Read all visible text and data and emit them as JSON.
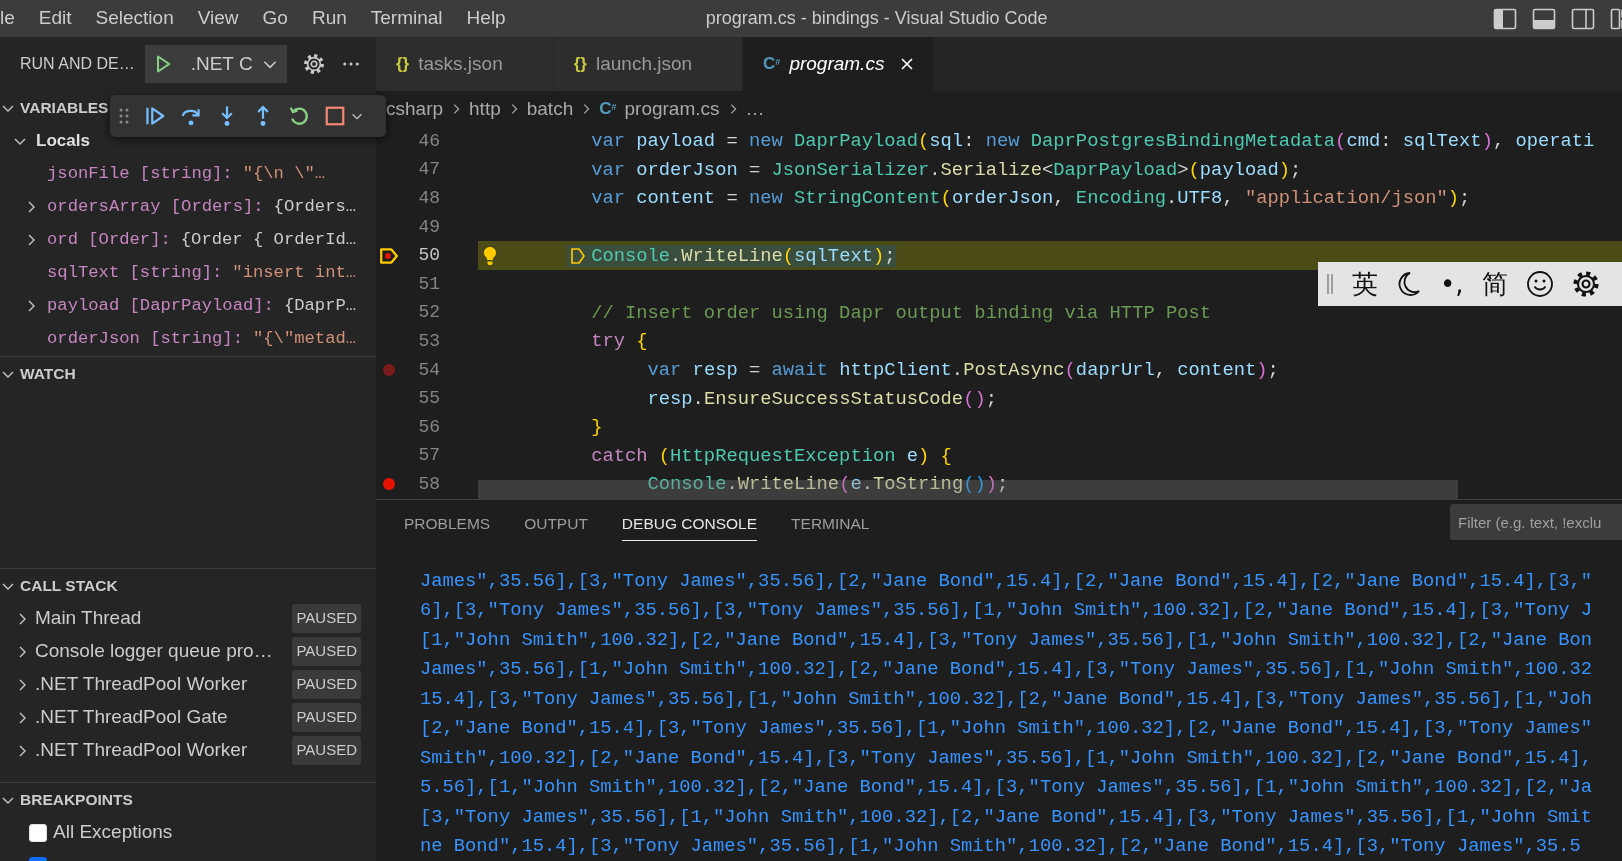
{
  "menu": [
    "le",
    "Edit",
    "Selection",
    "View",
    "Go",
    "Run",
    "Terminal",
    "Help"
  ],
  "window": {
    "title": "program.cs - bindings - Visual Studio Code"
  },
  "debug_header": {
    "title": "RUN AND DE…",
    "config": ".NET C"
  },
  "sections": [
    {
      "title": "VARIABLES",
      "expanded": true,
      "kind": "variables",
      "scopes": [
        {
          "label": "Locals",
          "expanded": true,
          "children": [
            {
              "label": "jsonFile [string]:",
              "value": "\"{\\n    \\\"…",
              "kind": "string",
              "expandable": false
            },
            {
              "label": "ordersArray [Orders]:",
              "value": "{Orders…",
              "kind": "object",
              "expandable": true
            },
            {
              "label": "ord [Order]:",
              "value": "{Order { OrderId…",
              "kind": "object",
              "expandable": true
            },
            {
              "label": "sqlText [string]:",
              "value": "\"insert int…",
              "kind": "string",
              "expandable": false
            },
            {
              "label": "payload [DaprPayload]:",
              "value": "{DaprP…",
              "kind": "object",
              "expandable": true
            },
            {
              "label": "orderJson [string]:",
              "value": "\"{\\\"metad…",
              "kind": "string",
              "expandable": false
            }
          ]
        }
      ]
    },
    {
      "title": "WATCH",
      "expanded": true,
      "kind": "watch"
    },
    {
      "title": "CALL STACK",
      "expanded": true,
      "kind": "threads",
      "items": [
        {
          "label": "Main Thread",
          "status": "PAUSED",
          "expanded": false
        },
        {
          "label": "Console logger queue pro…",
          "status": "PAUSED",
          "expanded": false
        },
        {
          "label": ".NET ThreadPool Worker",
          "status": "PAUSED",
          "expanded": false
        },
        {
          "label": ".NET ThreadPool Gate",
          "status": "PAUSED",
          "expanded": false
        },
        {
          "label": ".NET ThreadPool Worker",
          "status": "PAUSED",
          "expanded": false
        }
      ]
    },
    {
      "title": "BREAKPOINTS",
      "expanded": true,
      "kind": "breakpoints",
      "items": [
        {
          "label": "All Exceptions",
          "checked": false
        },
        {
          "checked": true
        }
      ]
    }
  ],
  "tabs": [
    {
      "label": "tasks.json",
      "glyph": "{}",
      "kind": "json",
      "selected": false,
      "preview": false
    },
    {
      "label": "launch.json",
      "glyph": "{}",
      "kind": "json",
      "selected": false,
      "preview": false
    },
    {
      "label": "program.cs",
      "glyph": "C$^{#}$",
      "kind": "csharp",
      "selected": true,
      "preview": true
    }
  ],
  "breadcrumb": [
    {
      "label": "csharp"
    },
    {
      "label": "http"
    },
    {
      "label": "batch"
    },
    {
      "label": "program.cs",
      "glyph": "C$^{#}$"
    },
    {
      "label": "…"
    }
  ],
  "editor": {
    "lines": [
      {
        "number": "46",
        "tokens": [
          {
            "text": "var ",
            "kind": "kw"
          },
          {
            "text": "payload",
            "kind": "var"
          },
          {
            "text": " = ",
            "kind": "p"
          },
          {
            "text": "new ",
            "kind": "kw"
          },
          {
            "text": "DaprPayload",
            "kind": "type"
          },
          {
            "text": "(",
            "kind": "b1"
          },
          {
            "text": "sql",
            "kind": "var"
          },
          {
            "text": ": ",
            "kind": "p"
          },
          {
            "text": "new ",
            "kind": "kw"
          },
          {
            "text": "DaprPostgresBindingMetadata",
            "kind": "type"
          },
          {
            "text": "(",
            "kind": "b2"
          },
          {
            "text": "cmd",
            "kind": "var"
          },
          {
            "text": ": ",
            "kind": "p"
          },
          {
            "text": "sqlText",
            "kind": "var"
          },
          {
            "text": ")",
            "kind": "b2"
          },
          {
            "text": ", ",
            "kind": "p"
          },
          {
            "text": "operati",
            "kind": "var"
          }
        ]
      },
      {
        "number": "47",
        "tokens": [
          {
            "text": "var ",
            "kind": "kw"
          },
          {
            "text": "orderJson",
            "kind": "var"
          },
          {
            "text": " = ",
            "kind": "p"
          },
          {
            "text": "JsonSerializer",
            "kind": "type"
          },
          {
            "text": ".",
            "kind": "p"
          },
          {
            "text": "Serialize",
            "kind": "fn"
          },
          {
            "text": "<",
            "kind": "p"
          },
          {
            "text": "DaprPayload",
            "kind": "type"
          },
          {
            "text": ">",
            "kind": "p"
          },
          {
            "text": "(",
            "kind": "b1"
          },
          {
            "text": "payload",
            "kind": "var"
          },
          {
            "text": ")",
            "kind": "b1"
          },
          {
            "text": ";",
            "kind": "p"
          }
        ]
      },
      {
        "number": "48",
        "tokens": [
          {
            "text": "var ",
            "kind": "kw"
          },
          {
            "text": "content",
            "kind": "var"
          },
          {
            "text": " = ",
            "kind": "p"
          },
          {
            "text": "new ",
            "kind": "kw"
          },
          {
            "text": "StringContent",
            "kind": "type"
          },
          {
            "text": "(",
            "kind": "b1"
          },
          {
            "text": "orderJson",
            "kind": "var"
          },
          {
            "text": ", ",
            "kind": "p"
          },
          {
            "text": "Encoding",
            "kind": "type"
          },
          {
            "text": ".",
            "kind": "p"
          },
          {
            "text": "UTF8",
            "kind": "var"
          },
          {
            "text": ", ",
            "kind": "p"
          },
          {
            "text": "\"application/json\"",
            "kind": "str"
          },
          {
            "text": ")",
            "kind": "b1"
          },
          {
            "text": ";",
            "kind": "p"
          }
        ]
      },
      {
        "number": "49"
      },
      {
        "number": "50",
        "breakpoint": true,
        "verified": true,
        "current": true,
        "lightbulb": true,
        "tokens": [
          {
            "text": "Console",
            "kind": "type"
          },
          {
            "text": ".",
            "kind": "p"
          },
          {
            "text": "WriteLine",
            "kind": "fn"
          },
          {
            "text": "(",
            "kind": "b1"
          },
          {
            "text": "sqlText",
            "kind": "var"
          },
          {
            "text": ")",
            "kind": "b1"
          },
          {
            "text": ";",
            "kind": "p"
          }
        ]
      },
      {
        "number": "51"
      },
      {
        "number": "52",
        "tokens": [
          {
            "text": "// Insert order using Dapr output binding via HTTP Post",
            "kind": "com"
          }
        ]
      },
      {
        "number": "53",
        "tokens": [
          {
            "text": "try ",
            "kind": "ctl"
          },
          {
            "text": "{",
            "kind": "b1"
          }
        ],
        "children": [
          {
            "number": "54",
            "breakpoint": true,
            "verified": false,
            "tokens": [
              {
                "text": "var ",
                "kind": "kw"
              },
              {
                "text": "resp",
                "kind": "var"
              },
              {
                "text": " = ",
                "kind": "p"
              },
              {
                "text": "await ",
                "kind": "kw"
              },
              {
                "text": "httpClient",
                "kind": "var"
              },
              {
                "text": ".",
                "kind": "p"
              },
              {
                "text": "PostAsync",
                "kind": "fn"
              },
              {
                "text": "(",
                "kind": "b2"
              },
              {
                "text": "daprUrl",
                "kind": "var"
              },
              {
                "text": ", ",
                "kind": "p"
              },
              {
                "text": "content",
                "kind": "var"
              },
              {
                "text": ")",
                "kind": "b2"
              },
              {
                "text": ";",
                "kind": "p"
              }
            ]
          },
          {
            "number": "55",
            "tokens": [
              {
                "text": "resp",
                "kind": "var"
              },
              {
                "text": ".",
                "kind": "p"
              },
              {
                "text": "EnsureSuccessStatusCode",
                "kind": "fn"
              },
              {
                "text": "()",
                "kind": "b2"
              },
              {
                "text": ";",
                "kind": "p"
              }
            ]
          }
        ]
      },
      {
        "number": "56",
        "tokens": [
          {
            "text": "}",
            "kind": "b1"
          }
        ]
      },
      {
        "number": "57",
        "tokens": [
          {
            "text": "catch ",
            "kind": "ctl"
          },
          {
            "text": "(",
            "kind": "b1"
          },
          {
            "text": "HttpRequestException ",
            "kind": "type"
          },
          {
            "text": "e",
            "kind": "var"
          },
          {
            "text": ") {",
            "kind": "b1"
          }
        ],
        "children": [
          {
            "number": "58",
            "breakpoint": true,
            "verified": true,
            "tokens": [
              {
                "text": "Console",
                "kind": "type"
              },
              {
                "text": ".",
                "kind": "p"
              },
              {
                "text": "WriteLine",
                "kind": "fn"
              },
              {
                "text": "(",
                "kind": "b2"
              },
              {
                "text": "e",
                "kind": "var"
              },
              {
                "text": ".",
                "kind": "p"
              },
              {
                "text": "ToString",
                "kind": "fn"
              },
              {
                "text": "()",
                "kind": "b3"
              },
              {
                "text": ")",
                "kind": "b2"
              },
              {
                "text": ";",
                "kind": "p"
              }
            ]
          }
        ]
      }
    ]
  },
  "ime_toolbar": [
    {
      "kind": "text",
      "text": "英"
    },
    {
      "kind": "moon"
    },
    {
      "kind": "text",
      "text": "•,"
    },
    {
      "kind": "text",
      "text": "简"
    },
    {
      "kind": "smiley"
    },
    {
      "kind": "gear"
    }
  ],
  "panel": {
    "tabs": [
      {
        "label": "PROBLEMS",
        "selected": false
      },
      {
        "label": "OUTPUT",
        "selected": false
      },
      {
        "label": "DEBUG CONSOLE",
        "selected": true
      },
      {
        "label": "TERMINAL",
        "selected": false
      }
    ],
    "filter": {
      "placeholder": "Filter (e.g. text, !exclu"
    },
    "console": [
      "James\",35.56],[3,\"Tony James\",35.56],[2,\"Jane Bond\",15.4],[2,\"Jane Bond\",15.4],[2,\"Jane Bond\",15.4],[3,\"",
      "6],[3,\"Tony James\",35.56],[3,\"Tony James\",35.56],[1,\"John Smith\",100.32],[2,\"Jane Bond\",15.4],[3,\"Tony J",
      "[1,\"John Smith\",100.32],[2,\"Jane Bond\",15.4],[3,\"Tony James\",35.56],[1,\"John Smith\",100.32],[2,\"Jane Bon",
      "James\",35.56],[1,\"John Smith\",100.32],[2,\"Jane Bond\",15.4],[3,\"Tony James\",35.56],[1,\"John Smith\",100.32",
      "15.4],[3,\"Tony James\",35.56],[1,\"John Smith\",100.32],[2,\"Jane Bond\",15.4],[3,\"Tony James\",35.56],[1,\"Joh",
      "[2,\"Jane Bond\",15.4],[3,\"Tony James\",35.56],[1,\"John Smith\",100.32],[2,\"Jane Bond\",15.4],[3,\"Tony James\"",
      "Smith\",100.32],[2,\"Jane Bond\",15.4],[3,\"Tony James\",35.56],[1,\"John Smith\",100.32],[2,\"Jane Bond\",15.4],",
      "5.56],[1,\"John Smith\",100.32],[2,\"Jane Bond\",15.4],[3,\"Tony James\",35.56],[1,\"John Smith\",100.32],[2,\"Ja",
      "[3,\"Tony James\",35.56],[1,\"John Smith\",100.32],[2,\"Jane Bond\",15.4],[3,\"Tony James\",35.56],[1,\"John Smit",
      "ne Bond\",15.4],[3,\"Tony James\",35.56],[1,\"John Smith\",100.32],[2,\"Jane Bond\",15.4],[3,\"Tony James\",35.5"
    ]
  }
}
